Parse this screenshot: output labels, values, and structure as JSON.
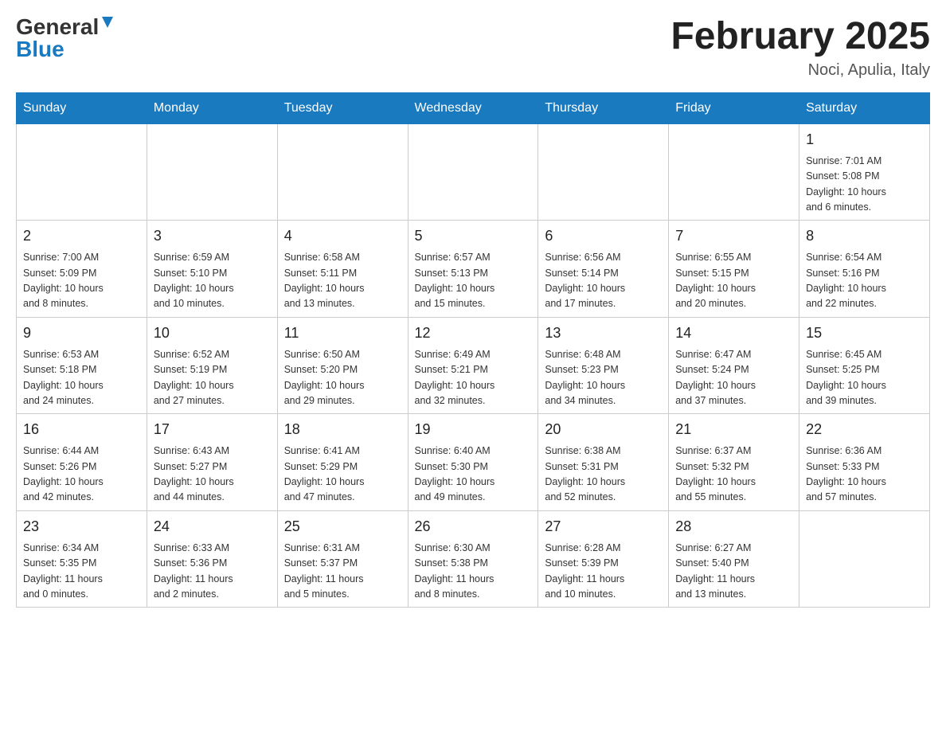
{
  "header": {
    "logo_general": "General",
    "logo_blue": "Blue",
    "month_title": "February 2025",
    "location": "Noci, Apulia, Italy"
  },
  "days_of_week": [
    "Sunday",
    "Monday",
    "Tuesday",
    "Wednesday",
    "Thursday",
    "Friday",
    "Saturday"
  ],
  "weeks": [
    {
      "days": [
        {
          "number": "",
          "info": ""
        },
        {
          "number": "",
          "info": ""
        },
        {
          "number": "",
          "info": ""
        },
        {
          "number": "",
          "info": ""
        },
        {
          "number": "",
          "info": ""
        },
        {
          "number": "",
          "info": ""
        },
        {
          "number": "1",
          "info": "Sunrise: 7:01 AM\nSunset: 5:08 PM\nDaylight: 10 hours\nand 6 minutes."
        }
      ]
    },
    {
      "days": [
        {
          "number": "2",
          "info": "Sunrise: 7:00 AM\nSunset: 5:09 PM\nDaylight: 10 hours\nand 8 minutes."
        },
        {
          "number": "3",
          "info": "Sunrise: 6:59 AM\nSunset: 5:10 PM\nDaylight: 10 hours\nand 10 minutes."
        },
        {
          "number": "4",
          "info": "Sunrise: 6:58 AM\nSunset: 5:11 PM\nDaylight: 10 hours\nand 13 minutes."
        },
        {
          "number": "5",
          "info": "Sunrise: 6:57 AM\nSunset: 5:13 PM\nDaylight: 10 hours\nand 15 minutes."
        },
        {
          "number": "6",
          "info": "Sunrise: 6:56 AM\nSunset: 5:14 PM\nDaylight: 10 hours\nand 17 minutes."
        },
        {
          "number": "7",
          "info": "Sunrise: 6:55 AM\nSunset: 5:15 PM\nDaylight: 10 hours\nand 20 minutes."
        },
        {
          "number": "8",
          "info": "Sunrise: 6:54 AM\nSunset: 5:16 PM\nDaylight: 10 hours\nand 22 minutes."
        }
      ]
    },
    {
      "days": [
        {
          "number": "9",
          "info": "Sunrise: 6:53 AM\nSunset: 5:18 PM\nDaylight: 10 hours\nand 24 minutes."
        },
        {
          "number": "10",
          "info": "Sunrise: 6:52 AM\nSunset: 5:19 PM\nDaylight: 10 hours\nand 27 minutes."
        },
        {
          "number": "11",
          "info": "Sunrise: 6:50 AM\nSunset: 5:20 PM\nDaylight: 10 hours\nand 29 minutes."
        },
        {
          "number": "12",
          "info": "Sunrise: 6:49 AM\nSunset: 5:21 PM\nDaylight: 10 hours\nand 32 minutes."
        },
        {
          "number": "13",
          "info": "Sunrise: 6:48 AM\nSunset: 5:23 PM\nDaylight: 10 hours\nand 34 minutes."
        },
        {
          "number": "14",
          "info": "Sunrise: 6:47 AM\nSunset: 5:24 PM\nDaylight: 10 hours\nand 37 minutes."
        },
        {
          "number": "15",
          "info": "Sunrise: 6:45 AM\nSunset: 5:25 PM\nDaylight: 10 hours\nand 39 minutes."
        }
      ]
    },
    {
      "days": [
        {
          "number": "16",
          "info": "Sunrise: 6:44 AM\nSunset: 5:26 PM\nDaylight: 10 hours\nand 42 minutes."
        },
        {
          "number": "17",
          "info": "Sunrise: 6:43 AM\nSunset: 5:27 PM\nDaylight: 10 hours\nand 44 minutes."
        },
        {
          "number": "18",
          "info": "Sunrise: 6:41 AM\nSunset: 5:29 PM\nDaylight: 10 hours\nand 47 minutes."
        },
        {
          "number": "19",
          "info": "Sunrise: 6:40 AM\nSunset: 5:30 PM\nDaylight: 10 hours\nand 49 minutes."
        },
        {
          "number": "20",
          "info": "Sunrise: 6:38 AM\nSunset: 5:31 PM\nDaylight: 10 hours\nand 52 minutes."
        },
        {
          "number": "21",
          "info": "Sunrise: 6:37 AM\nSunset: 5:32 PM\nDaylight: 10 hours\nand 55 minutes."
        },
        {
          "number": "22",
          "info": "Sunrise: 6:36 AM\nSunset: 5:33 PM\nDaylight: 10 hours\nand 57 minutes."
        }
      ]
    },
    {
      "days": [
        {
          "number": "23",
          "info": "Sunrise: 6:34 AM\nSunset: 5:35 PM\nDaylight: 11 hours\nand 0 minutes."
        },
        {
          "number": "24",
          "info": "Sunrise: 6:33 AM\nSunset: 5:36 PM\nDaylight: 11 hours\nand 2 minutes."
        },
        {
          "number": "25",
          "info": "Sunrise: 6:31 AM\nSunset: 5:37 PM\nDaylight: 11 hours\nand 5 minutes."
        },
        {
          "number": "26",
          "info": "Sunrise: 6:30 AM\nSunset: 5:38 PM\nDaylight: 11 hours\nand 8 minutes."
        },
        {
          "number": "27",
          "info": "Sunrise: 6:28 AM\nSunset: 5:39 PM\nDaylight: 11 hours\nand 10 minutes."
        },
        {
          "number": "28",
          "info": "Sunrise: 6:27 AM\nSunset: 5:40 PM\nDaylight: 11 hours\nand 13 minutes."
        },
        {
          "number": "",
          "info": ""
        }
      ]
    }
  ]
}
